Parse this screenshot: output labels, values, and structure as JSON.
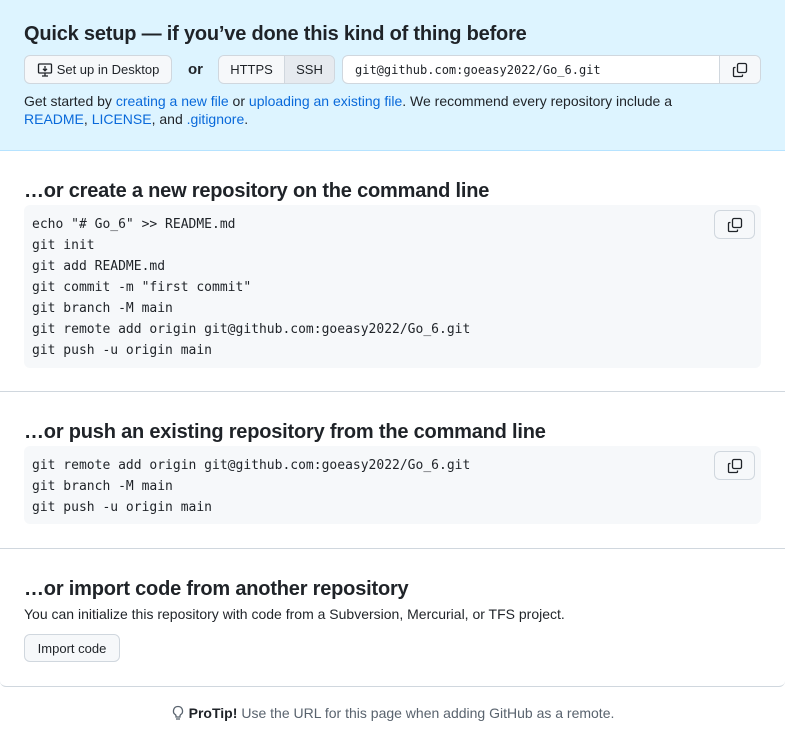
{
  "quick_setup": {
    "title": "Quick setup — if you’ve done this kind of thing before",
    "desktop_button": "Set up in Desktop",
    "or_label": "or",
    "protocols": [
      "HTTPS",
      "SSH"
    ],
    "selected_protocol": "SSH",
    "clone_url": "git@github.com:goeasy2022/Go_6.git",
    "get_started": {
      "prefix": "Get started by ",
      "link_new_file": "creating a new file",
      "middle": " or ",
      "link_upload": "uploading an existing file",
      "suffix": ". We recommend every repository include a",
      "link_readme": "README",
      "comma": ", ",
      "link_license": "LICENSE",
      "and": ", and ",
      "link_gitignore": ".gitignore",
      "end": "."
    }
  },
  "create_section": {
    "title": "…or create a new repository on the command line",
    "code": "echo \"# Go_6\" >> README.md\ngit init\ngit add README.md\ngit commit -m \"first commit\"\ngit branch -M main\ngit remote add origin git@github.com:goeasy2022/Go_6.git\ngit push -u origin main"
  },
  "push_section": {
    "title": "…or push an existing repository from the command line",
    "code": "git remote add origin git@github.com:goeasy2022/Go_6.git\ngit branch -M main\ngit push -u origin main"
  },
  "import_section": {
    "title": "…or import code from another repository",
    "description": "You can initialize this repository with code from a Subversion, Mercurial, or TFS project.",
    "button": "Import code"
  },
  "protip": {
    "label": "ProTip!",
    "text": "Use the URL for this page when adding GitHub as a remote."
  },
  "icons": {
    "desktop": "desktop-download-icon",
    "copy": "copy-icon",
    "bulb": "light-bulb-icon"
  },
  "colors": {
    "quick_bg": "#ddf4ff",
    "link": "#0969da",
    "code_bg": "#f6f8fa",
    "border": "#d0d7de"
  }
}
